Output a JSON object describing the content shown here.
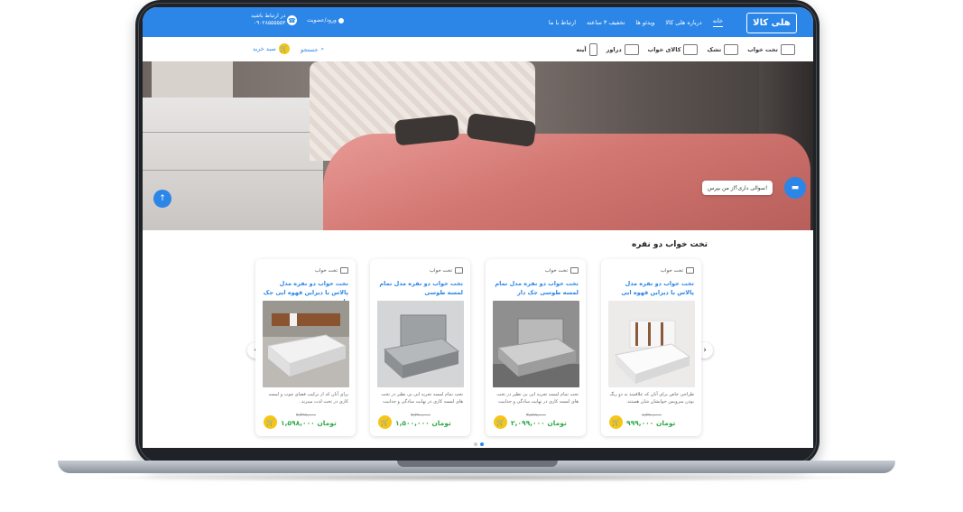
{
  "header": {
    "logo_text": "هلی کالا",
    "nav": [
      "خانه",
      "درباره هلی کالا",
      "ویدئو ها",
      "تخفیف ۳ ساعته",
      "ارتباط با ما"
    ],
    "contact_label": "در ارتباط باشید",
    "contact_phone": "۰۹۰۲۸۵۵۵۵۵۳",
    "login_label": "ورود/عضویت"
  },
  "categories": [
    "تخت خواب",
    "تشک",
    "کالای خواب",
    "دراور",
    "آینه"
  ],
  "search_label": "جستجو",
  "cart_label": "سبد خرید",
  "chat_prompt": "سوالی داری؟از من بپرس!",
  "section_title": "تخت خواب دو نفره",
  "currency": "تومان",
  "products": [
    {
      "category": "تخت خواب",
      "title": "تخت خواب دو نفره مدل پالاس با دیزاین قهوه ایی",
      "desc": "طراحی خاص برای آنان که علاقمند به دو رنگ بودن سرویس خوابشان شان هستند.",
      "old_price": "۱,۲۹۰,۰۰۰",
      "price": "۹۹۹,۰۰۰"
    },
    {
      "category": "تخت خواب",
      "title": "تخت خواب دو نفره مدل تمام لمسه طوسی جک دار",
      "desc": "تخت تمام لمسه تجربه ایی بی نظیر در تخت های لمسه کاری در نهایت سادگی و جذابیت",
      "old_price": "۳,۸۹۹,۰۰۰",
      "price": "۲,۰۹۹,۰۰۰"
    },
    {
      "category": "تخت خواب",
      "title": "تخت خواب دو نفره مدل تمام لمسه طوسی",
      "desc": "تخت تمام لمسه تجربه ایی بی نظیر در تخت های لمسه کاری در نهایت سادگی و جذابیت",
      "old_price": "۲,۲۹۰,۰۰۰",
      "price": "۱,۵۰۰,۰۰۰"
    },
    {
      "category": "تخت خواب",
      "title": "تخت خواب دو نفره مدل پالاس با دیزاین قهوه ایی جک دار",
      "desc": "برای آنان که از ترکیب فضای چوب و لمسه کاری در تخت لذت میبرند .",
      "old_price": "۲,۴۹۹,۰۰۰",
      "price": "۱,۵۹۸,۰۰۰"
    }
  ],
  "colors": {
    "primary": "#2b86e8",
    "price": "#2faa4a",
    "cart": "#f5c518"
  }
}
